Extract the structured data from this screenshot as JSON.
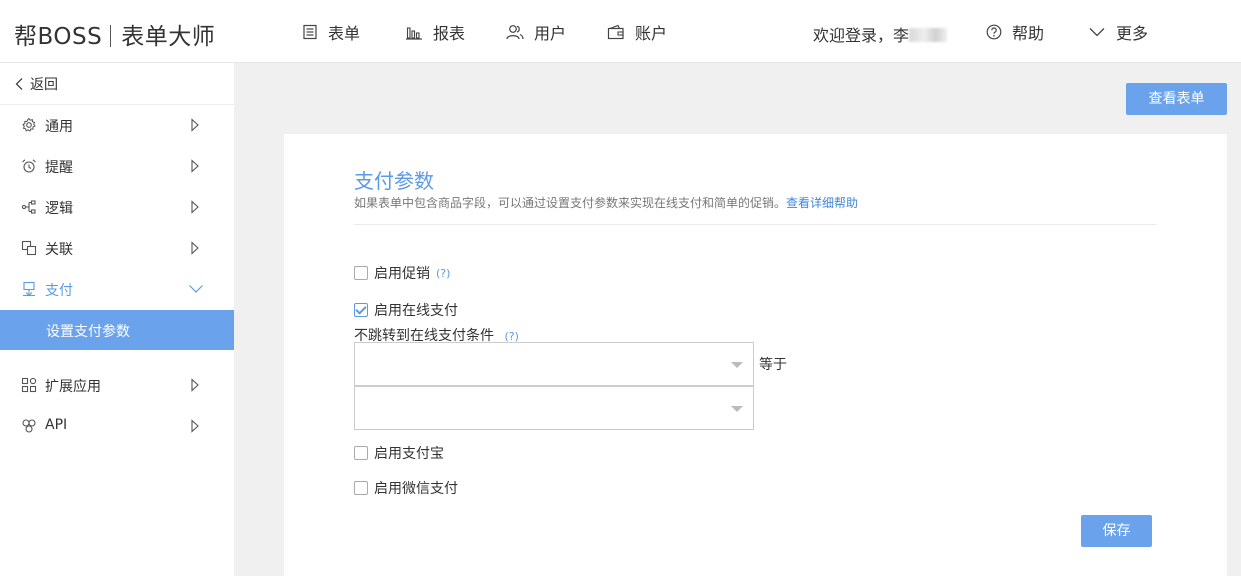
{
  "header": {
    "logo_brand": "帮BOSS",
    "logo_product": "表单大师",
    "nav": [
      {
        "label": "表单",
        "icon": "form-icon"
      },
      {
        "label": "报表",
        "icon": "bar-chart-icon"
      },
      {
        "label": "用户",
        "icon": "users-icon"
      },
      {
        "label": "账户",
        "icon": "wallet-icon"
      }
    ],
    "welcome_text": "欢迎登录，李",
    "help_label": "帮助",
    "more_label": "更多"
  },
  "sidebar": {
    "back_label": "返回",
    "items": [
      {
        "label": "通用",
        "icon": "gear-icon"
      },
      {
        "label": "提醒",
        "icon": "alarm-clock-icon"
      },
      {
        "label": "逻辑",
        "icon": "logic-tree-icon"
      },
      {
        "label": "关联",
        "icon": "link-copy-icon"
      },
      {
        "label": "支付",
        "icon": "payment-icon",
        "expanded": true
      },
      {
        "label": "扩展应用",
        "icon": "apps-grid-icon"
      },
      {
        "label": "API",
        "icon": "api-icon"
      }
    ],
    "active_sub_item": "设置支付参数"
  },
  "main": {
    "view_form_button": "查看表单",
    "title": "支付参数",
    "description": "如果表单中包含商品字段，可以通过设置支付参数来实现在线支付和简单的促销。",
    "description_link": "查看详细帮助",
    "help_marker": "(?)",
    "enable_promotion": {
      "label": "启用促销",
      "checked": false
    },
    "enable_online_payment": {
      "label": "启用在线支付",
      "checked": true
    },
    "no_redirect_label": "不跳转到在线支付条件",
    "condition_field_value": "",
    "equals_label": "等于",
    "condition_value_value": "",
    "enable_alipay": {
      "label": "启用支付宝",
      "checked": false
    },
    "enable_wechat_pay": {
      "label": "启用微信支付",
      "checked": false
    },
    "save_button": "保存"
  },
  "colors": {
    "accent": "#6aa3ec",
    "accent_text": "#5b9ae6",
    "link": "#3f86d8"
  }
}
